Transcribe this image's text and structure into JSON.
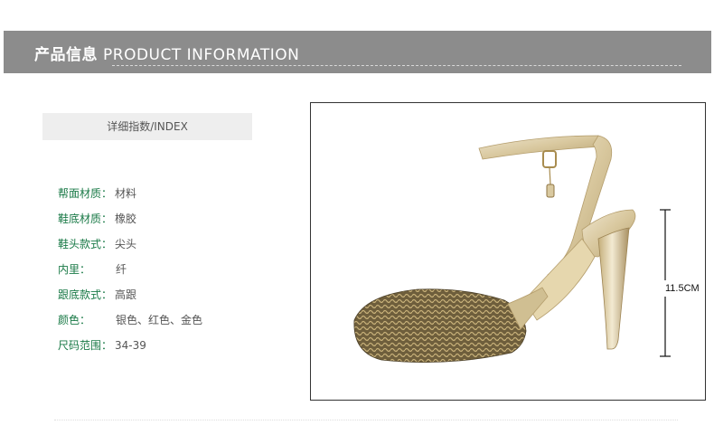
{
  "header": {
    "title_cn": "产品信息",
    "title_en": "PRODUCT INFORMATION"
  },
  "index_box": {
    "label": "详细指数/INDEX"
  },
  "specs": [
    {
      "key": "帮面材质：",
      "value": "材料"
    },
    {
      "key": "鞋底材质：",
      "value": "橡胶"
    },
    {
      "key": "鞋头款式：",
      "value": "尖头"
    },
    {
      "key": "内里：",
      "value": "纤"
    },
    {
      "key": "跟底款式：",
      "value": "高跟"
    },
    {
      "key": "颜色：",
      "value": "银色、红色、金色"
    },
    {
      "key": "尺码范围：",
      "value": "34-39"
    }
  ],
  "product_image": {
    "height_label": "11.5CM"
  },
  "colors": {
    "header_bg": "#8c8c8c",
    "spec_key": "#1a7a47",
    "spec_value": "#555555"
  }
}
